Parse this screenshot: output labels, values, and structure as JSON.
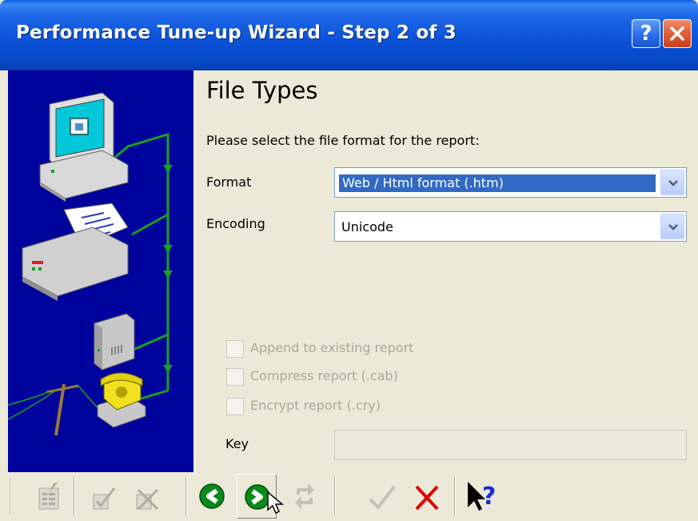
{
  "window": {
    "title": "Performance Tune-up Wizard - Step 2 of 3",
    "help_glyph": "?",
    "close_icon": "close-icon",
    "title_bar_color": "#0a50d6"
  },
  "side_panel": {
    "background": "#01049c",
    "icons": [
      "computer-icon",
      "printer-icon",
      "modem-icon",
      "telephone-icon",
      "utility-pole-icon"
    ]
  },
  "page": {
    "heading": "File Types",
    "instruction": "Please select the file format for the report:"
  },
  "form": {
    "format_label": "Format",
    "format_value": "Web / Html format (.htm)",
    "encoding_label": "Encoding",
    "encoding_value": "Unicode",
    "append_label": "Append to existing report",
    "compress_label": "Compress report (.cab)",
    "encrypt_label": "Encrypt report (.cry)",
    "key_label": "Key",
    "key_value": ""
  },
  "toolbar": {
    "items": [
      {
        "icon": "form-icon",
        "enabled": false
      },
      {
        "icon": "check-box-icon",
        "enabled": false
      },
      {
        "icon": "cross-box-icon",
        "enabled": false
      },
      {
        "icon": "back-arrow-icon",
        "enabled": true
      },
      {
        "icon": "next-arrow-icon",
        "enabled": true,
        "pressed": true
      },
      {
        "icon": "repeat-icon",
        "enabled": false
      },
      {
        "icon": "checkmark-icon",
        "enabled": false
      },
      {
        "icon": "cancel-x-icon",
        "enabled": true
      },
      {
        "icon": "context-help-icon",
        "enabled": true
      }
    ],
    "accent_green": "#0a8a1a",
    "cancel_red": "#e00000"
  }
}
